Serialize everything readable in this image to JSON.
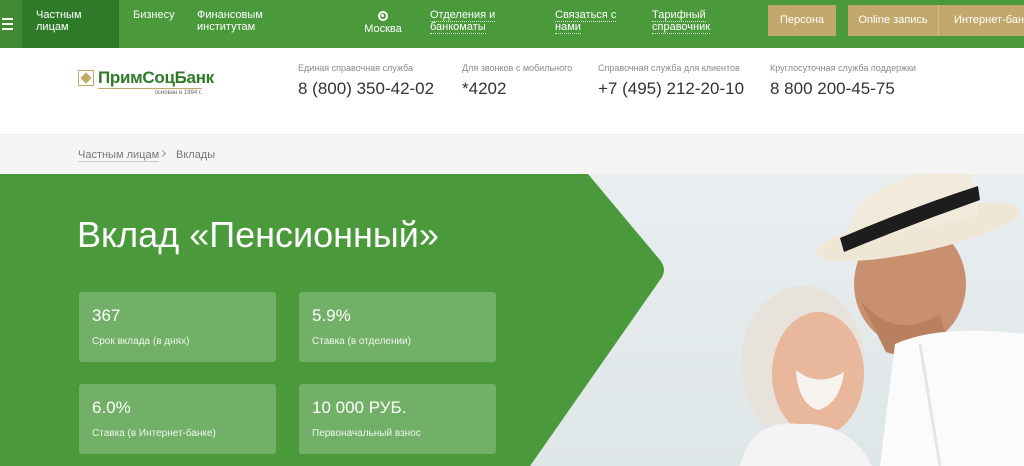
{
  "topnav": {
    "items": [
      {
        "label": "Частным\nлицам"
      },
      {
        "label": "Бизнесу"
      },
      {
        "label": "Финансовым\nинститутам"
      },
      {
        "label": "Москва"
      },
      {
        "label": "Отделения и\nбанкоматы"
      },
      {
        "label": "Связаться с\nнами"
      },
      {
        "label": "Тарифный\nсправочник"
      }
    ],
    "buttons": {
      "persona": "Персона",
      "online": "Online запись",
      "internet_bank": "Интернет-банк"
    }
  },
  "logo": {
    "name": "ПримСоцБанк",
    "tagline": "основан в 1994 г."
  },
  "contacts": [
    {
      "label": "Единая справочная служба",
      "phone": "8 (800) 350-42-02"
    },
    {
      "label": "Для звонков с мобильного",
      "phone": "*4202"
    },
    {
      "label": "Справочная служба для клиентов",
      "phone": "+7 (495) 212-20-10"
    },
    {
      "label": "Круглосуточная служба поддержки",
      "phone": "8 800 200-45-75"
    }
  ],
  "breadcrumb": {
    "parent": "Частным лицам",
    "current": "Вклады"
  },
  "hero": {
    "title": "Вклад «Пенсионный»",
    "cards": [
      {
        "value": "367",
        "label": "Срок вклада (в днях)"
      },
      {
        "value": "5.9%",
        "label": "Ставка (в отделении)"
      },
      {
        "value": "6.0%",
        "label": "Ставка (в Интернет-банке)"
      },
      {
        "value": "10 000 РУБ.",
        "label": "Первоначальный взнос"
      }
    ]
  },
  "colors": {
    "brand_green": "#4a9a3c",
    "dark_green": "#2f7a28",
    "gold": "#c2a86a"
  }
}
